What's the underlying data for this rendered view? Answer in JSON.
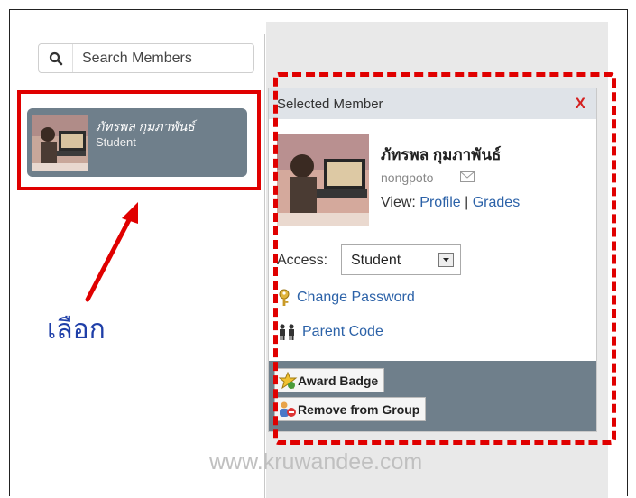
{
  "search": {
    "placeholder": "Search Members",
    "icon": "search-icon"
  },
  "member_list": [
    {
      "name": "ภัทรพล กุมภาพันธ์",
      "role": "Student"
    }
  ],
  "annotation": {
    "label": "เลือก",
    "highlight_color": "#e00000",
    "label_color": "#1f3fa8"
  },
  "selected_member": {
    "title": "Selected Member",
    "close_label": "X",
    "name": "ภัทรพล กุมภาพันธ์",
    "username": "nongpoto",
    "view_label": "View:",
    "profile_link": "Profile",
    "separator": "|",
    "grades_link": "Grades",
    "access_label": "Access:",
    "access_value": "Student",
    "change_password": "Change Password",
    "parent_code": "Parent Code",
    "award_badge": "Award Badge",
    "remove_from_group": "Remove from Group"
  },
  "watermark": "www.kruwandee.com",
  "colors": {
    "card_bg": "#6f7f8b",
    "link": "#2c62a8",
    "close": "#d42121",
    "header_bg": "#dfe3e8"
  }
}
